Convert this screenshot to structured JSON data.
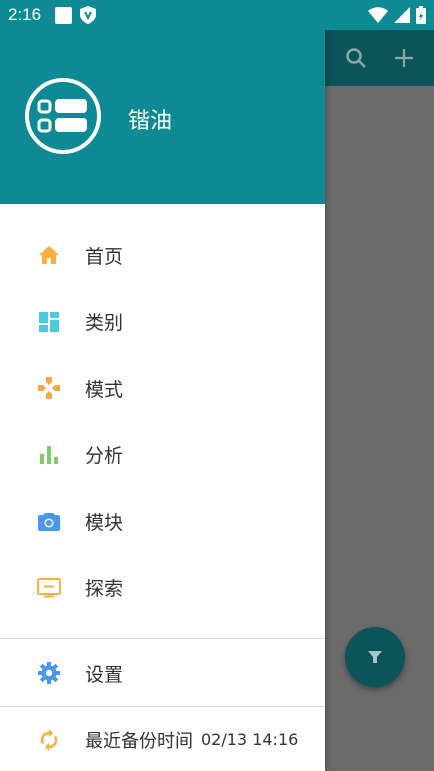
{
  "status_bar": {
    "time": "2:16"
  },
  "drawer": {
    "app_name": "锴油",
    "menu": [
      {
        "label": "首页",
        "icon": "home-icon",
        "color": "#f7b23b"
      },
      {
        "label": "类别",
        "icon": "dashboard-icon",
        "color": "#4dc9db"
      },
      {
        "label": "模式",
        "icon": "gamepad-icon",
        "color": "#f7a640"
      },
      {
        "label": "分析",
        "icon": "bar-chart-icon",
        "color": "#7fcc6b"
      },
      {
        "label": "模块",
        "icon": "camera-icon",
        "color": "#4a97f0"
      },
      {
        "label": "探索",
        "icon": "tv-icon",
        "color": "#f7b23b"
      }
    ],
    "settings": {
      "label": "设置",
      "icon": "gear-icon",
      "color": "#4a97f0"
    },
    "backup": {
      "label": "最近备份时间",
      "time": "02/13 14:16",
      "icon": "sync-icon",
      "color": "#f7b23b"
    }
  },
  "colors": {
    "primary": "#0e8a95",
    "primary_dark": "#0a545a",
    "scrim": "#6b6b6b"
  }
}
